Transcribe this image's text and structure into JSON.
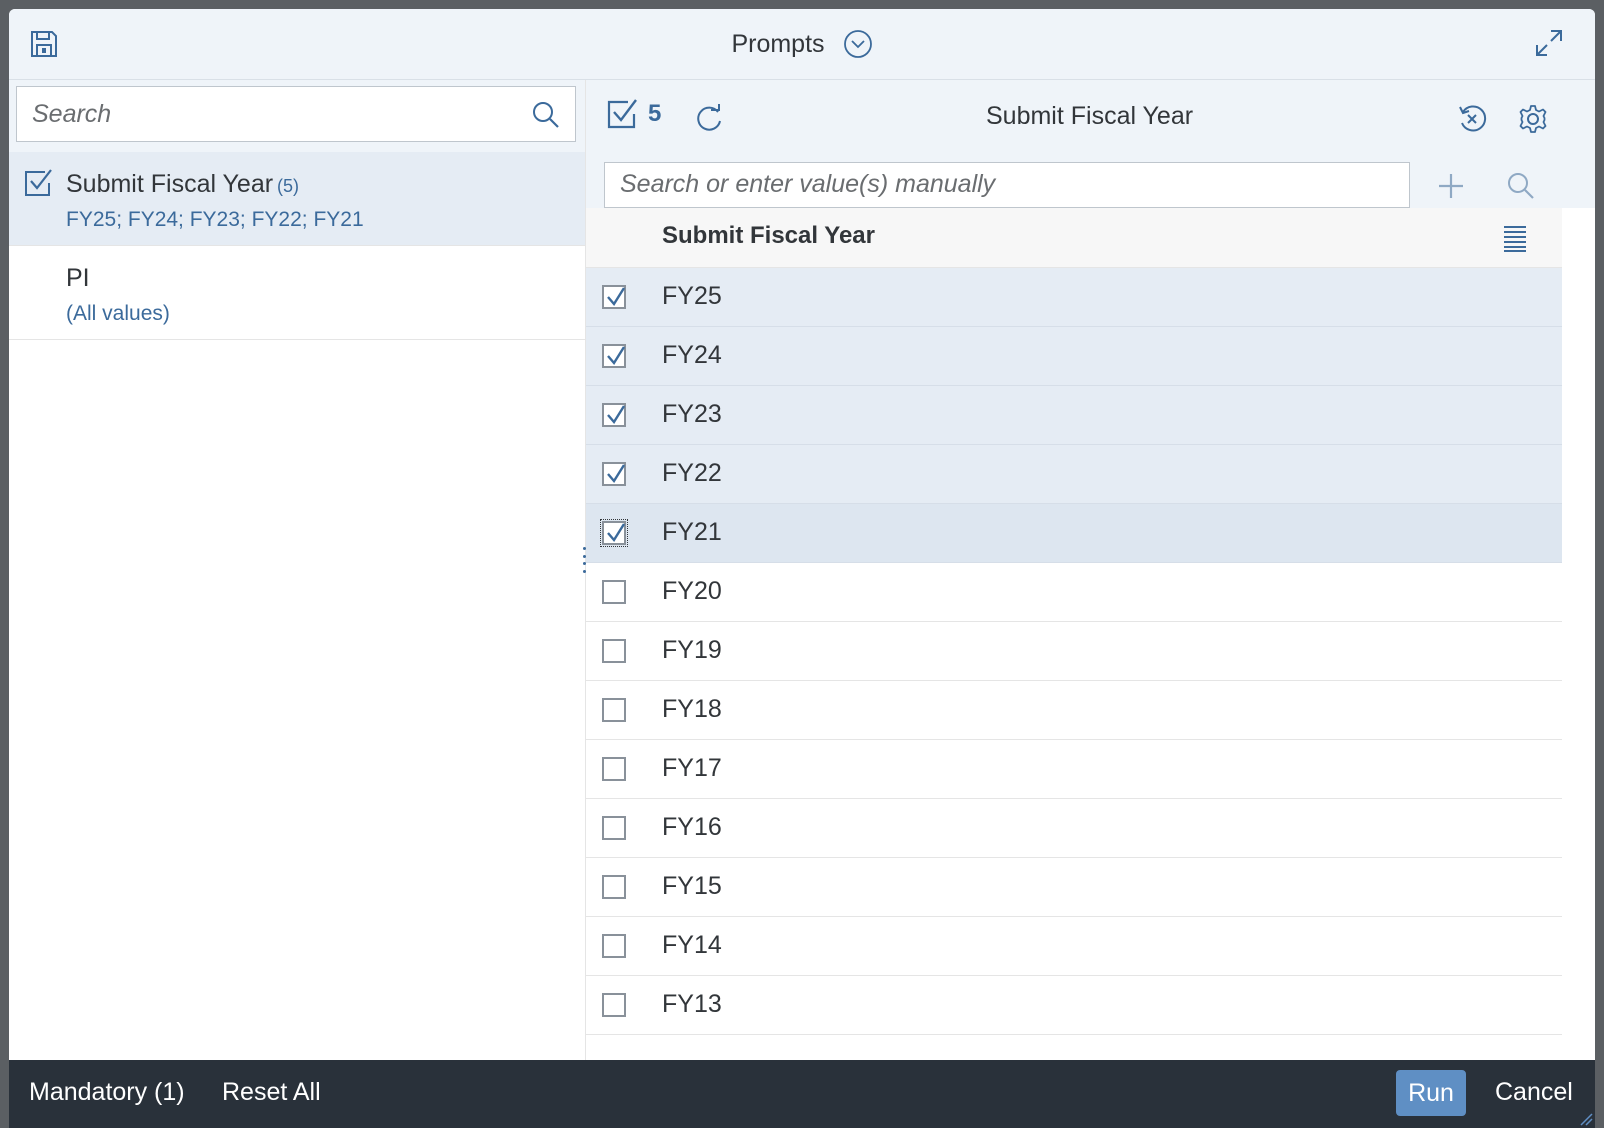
{
  "header": {
    "title": "Prompts"
  },
  "left_pane": {
    "search_placeholder": "Search",
    "prompts": [
      {
        "name": "Submit Fiscal Year",
        "count": "(5)",
        "values": "FY25; FY24; FY23; FY22; FY21",
        "selected": true
      },
      {
        "name": "PI",
        "count": "",
        "values": "(All values)",
        "selected": false
      }
    ]
  },
  "right_pane": {
    "selected_count": "5",
    "title": "Submit Fiscal Year",
    "value_input_placeholder": "Search or enter value(s) manually",
    "column_header": "Submit Fiscal Year",
    "values": [
      {
        "label": "FY25",
        "checked": true
      },
      {
        "label": "FY24",
        "checked": true
      },
      {
        "label": "FY23",
        "checked": true
      },
      {
        "label": "FY22",
        "checked": true
      },
      {
        "label": "FY21",
        "checked": true,
        "focused": true
      },
      {
        "label": "FY20",
        "checked": false
      },
      {
        "label": "FY19",
        "checked": false
      },
      {
        "label": "FY18",
        "checked": false
      },
      {
        "label": "FY17",
        "checked": false
      },
      {
        "label": "FY16",
        "checked": false
      },
      {
        "label": "FY15",
        "checked": false
      },
      {
        "label": "FY14",
        "checked": false
      },
      {
        "label": "FY13",
        "checked": false
      }
    ]
  },
  "footer": {
    "mandatory_label": "Mandatory (1)",
    "reset_label": "Reset All",
    "run_label": "Run",
    "cancel_label": "Cancel"
  },
  "colors": {
    "accent": "#3b6a9b",
    "selected_row": "#e5ecf4",
    "footer_bg": "#29313a",
    "run_button": "#5f8fc4"
  },
  "icons": {
    "save": "save-icon",
    "title_menu": "chevron-down-circle-icon",
    "expand": "expand-icon",
    "search": "search-icon",
    "selected": "checkbox-checked-icon",
    "refresh": "refresh-icon",
    "clear": "clear-selection-icon",
    "settings": "gear-icon",
    "add": "add-icon",
    "column_menu": "list-icon"
  }
}
